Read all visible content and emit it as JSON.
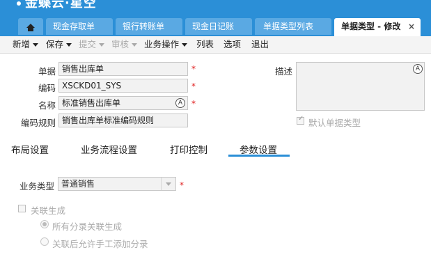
{
  "brand": {
    "name": "金蝶云·星空"
  },
  "tabs": [
    {
      "label": "现金存取单"
    },
    {
      "label": "银行转账单"
    },
    {
      "label": "现金日记账"
    },
    {
      "label": "单据类型列表"
    },
    {
      "label": "单据类型 - 修改",
      "active": true
    }
  ],
  "toolbar": {
    "items": [
      {
        "label": "新增",
        "dropdown": true,
        "enabled": true
      },
      {
        "label": "保存",
        "dropdown": true,
        "enabled": true
      },
      {
        "label": "提交",
        "dropdown": true,
        "enabled": false
      },
      {
        "label": "审核",
        "dropdown": true,
        "enabled": false
      },
      {
        "label": "业务操作",
        "dropdown": true,
        "enabled": true
      },
      {
        "label": "列表",
        "dropdown": false,
        "enabled": true
      },
      {
        "label": "选项",
        "dropdown": false,
        "enabled": true
      },
      {
        "label": "退出",
        "dropdown": false,
        "enabled": true
      }
    ]
  },
  "form": {
    "bill": {
      "label": "单据",
      "value": "销售出库单",
      "required": "*"
    },
    "code": {
      "label": "编码",
      "value": "XSCKD01_SYS",
      "required": "*"
    },
    "name": {
      "label": "名称",
      "value": "标准销售出库单",
      "required": "*"
    },
    "coderule": {
      "label": "编码规则",
      "value": "销售出库单标准编码规则"
    },
    "desc": {
      "label": "描述",
      "value": ""
    },
    "default_type": {
      "label": "默认单据类型",
      "checked": true
    }
  },
  "section_tabs": [
    {
      "label": "布局设置"
    },
    {
      "label": "业务流程设置"
    },
    {
      "label": "打印控制"
    },
    {
      "label": "参数设置",
      "active": true
    }
  ],
  "params": {
    "biz_type": {
      "label": "业务类型",
      "value": "普通销售",
      "required": "*"
    },
    "link_gen": {
      "label": "关联生成",
      "checked": false
    },
    "options": [
      {
        "label": "所有分录关联生成",
        "selected": true
      },
      {
        "label": "关联后允许手工添加分录",
        "selected": false
      }
    ]
  },
  "icons": {
    "home": "home-icon",
    "close": "close-icon",
    "multilang": "multilang-icon"
  },
  "colors": {
    "accent": "#2b8fd7",
    "required": "#e02020"
  }
}
